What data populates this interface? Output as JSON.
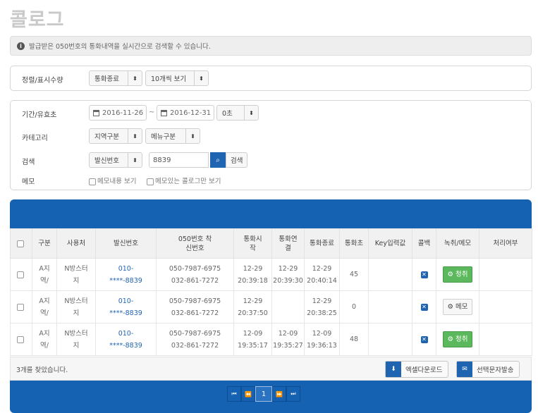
{
  "page": {
    "title": "콜로그"
  },
  "notice": {
    "text": "발급받은 050번호의 통화내역을 실시간으로 검색할 수 있습니다."
  },
  "sort_panel": {
    "label": "정렬/표시수량",
    "sort_select": "통화종료",
    "count_select": "10개씩 보기"
  },
  "filter_panel": {
    "period_label": "기간/유효초",
    "date_from": "2016-11-26",
    "date_to": "2016-12-31",
    "date_sep": "~",
    "seconds_select": "0초",
    "category_label": "카테고리",
    "region_select": "지역구분",
    "menu_select": "메뉴구분",
    "search_label": "검색",
    "search_field_select": "발신번호",
    "search_value": "8839",
    "search_button": "검색",
    "memo_label": "메모",
    "memo_check1": "메모내용 보기",
    "memo_check2": "메모있는 콜로그만 보기"
  },
  "table": {
    "headers": [
      "구분",
      "사용처",
      "발신번호",
      "050번호 착신번호",
      "통화시작",
      "통화연결",
      "통화종료",
      "통화초",
      "Key입력값",
      "콜백",
      "녹취/메모",
      "처리여부"
    ],
    "rows": [
      {
        "type1": "A지",
        "type2": "역/",
        "user1": "N방스터",
        "user2": "지",
        "caller1": "010-",
        "caller2": "****-8839",
        "vnum": "050-7987-6975",
        "dest": "032-861-7272",
        "start_d": "12-29",
        "start_t": "20:39:18",
        "conn_d": "12-29",
        "conn_t": "20:39:30",
        "end_d": "12-29",
        "end_t": "20:40:14",
        "secs": "45",
        "key": "",
        "action": "청취"
      },
      {
        "type1": "A지",
        "type2": "역/",
        "user1": "N방스터",
        "user2": "지",
        "caller1": "010-",
        "caller2": "****-8839",
        "vnum": "050-7987-6975",
        "dest": "032-861-7272",
        "start_d": "12-29",
        "start_t": "20:37:50",
        "conn_d": "",
        "conn_t": "",
        "end_d": "12-29",
        "end_t": "20:38:25",
        "secs": "0",
        "key": "",
        "action": "메모"
      },
      {
        "type1": "A지",
        "type2": "역/",
        "user1": "N방스터",
        "user2": "지",
        "caller1": "010-",
        "caller2": "****-8839",
        "vnum": "050-7987-6975",
        "dest": "032-861-7272",
        "start_d": "12-09",
        "start_t": "19:35:17",
        "conn_d": "12-09",
        "conn_t": "19:35:27",
        "end_d": "12-09",
        "end_t": "19:36:13",
        "secs": "48",
        "key": "",
        "action": "청취"
      }
    ]
  },
  "footer": {
    "count_text": "3개를 찾았습니다.",
    "excel_button": "엑셀다운로드",
    "sms_button": "선택문자발송"
  },
  "pagination": {
    "current": "1"
  },
  "colors": {
    "accent": "#1561b2",
    "green": "#5cb85c"
  }
}
